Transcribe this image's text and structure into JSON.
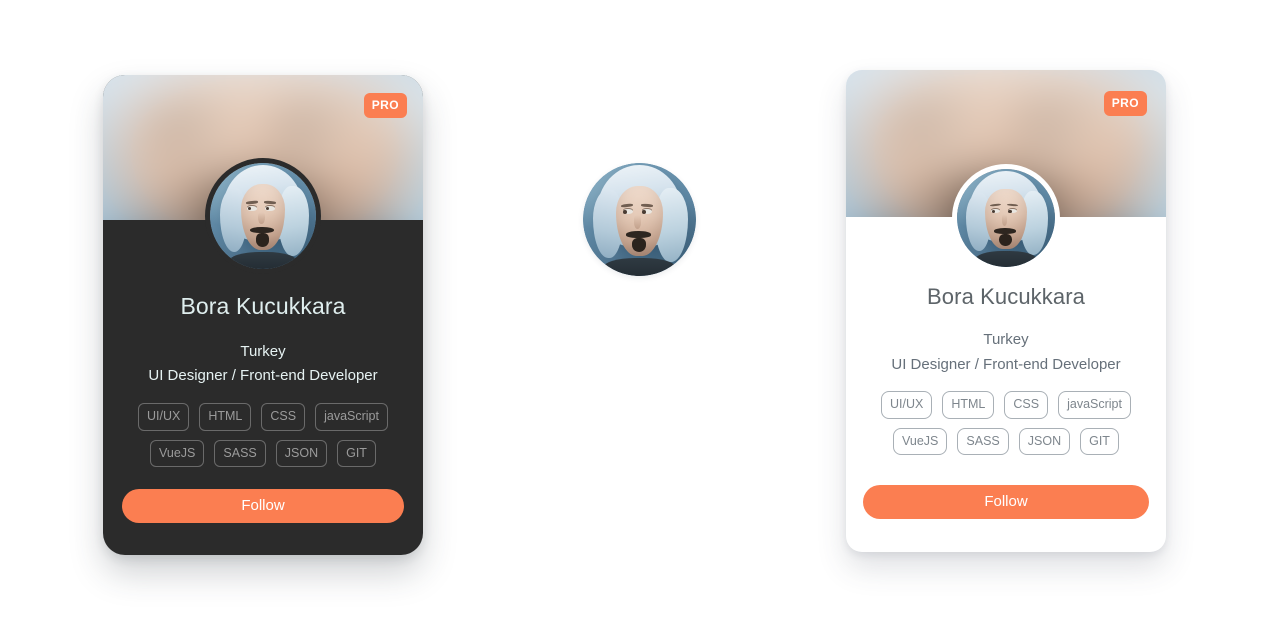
{
  "page": {
    "background_color": "#ffffff",
    "accent_color": "#fb7e51"
  },
  "profile": {
    "name": "Bora Kucukkara",
    "location": "Turkey",
    "role": "UI Designer / Front-end Developer",
    "badge": "PRO",
    "follow_label": "Follow",
    "skills": [
      "UI/UX",
      "HTML",
      "CSS",
      "javaScript",
      "VueJS",
      "SASS",
      "JSON",
      "GIT"
    ],
    "avatar_alt": "user-avatar-portrait"
  },
  "cards": {
    "dark": {
      "theme": "dark",
      "background_color": "#2b2b2b",
      "name_color": "#dfeeee",
      "text_color": "#e6f2f2",
      "tag_border_color": "#6a6a6a",
      "tag_text_color": "#9b9b9b",
      "button_color": "#fb7e51",
      "button_text_color": "#ffffff",
      "badge_color": "#fb7e51"
    },
    "light": {
      "theme": "light",
      "background_color": "#ffffff",
      "name_color": "#5d6469",
      "text_color": "#66707a",
      "tag_border_color": "#a9b0b6",
      "tag_text_color": "#7e868d",
      "button_color": "#fb7e51",
      "button_text_color": "#ffffff",
      "badge_color": "#fb7e51"
    }
  }
}
